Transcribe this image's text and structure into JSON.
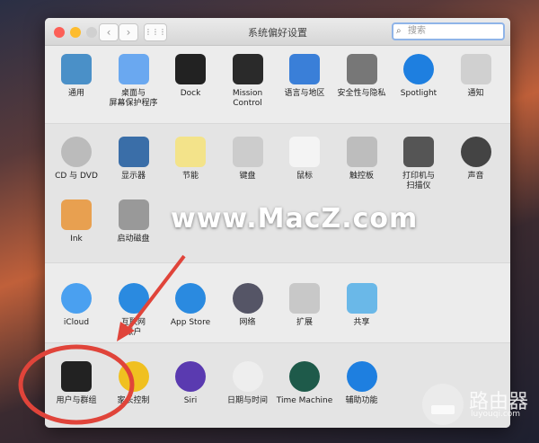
{
  "window": {
    "title": "系统偏好设置",
    "search_placeholder": "搜索",
    "back": "‹",
    "forward": "›",
    "grid": "⋮⋮⋮"
  },
  "sections": [
    [
      {
        "label": "通用",
        "icon": "general-icon",
        "color": "#4a90c8"
      },
      {
        "label": "桌面与\n屏幕保护程序",
        "icon": "desktop-icon",
        "color": "#6aa8f0"
      },
      {
        "label": "Dock",
        "icon": "dock-icon",
        "color": "#222"
      },
      {
        "label": "Mission\nControl",
        "icon": "mission-control-icon",
        "color": "#2a2a2a"
      },
      {
        "label": "语言与地区",
        "icon": "language-icon",
        "color": "#3a7fd8"
      },
      {
        "label": "安全性与隐私",
        "icon": "security-icon",
        "color": "#777"
      },
      {
        "label": "Spotlight",
        "icon": "spotlight-icon",
        "color": "#1e7fe0"
      },
      {
        "label": "通知",
        "icon": "notifications-icon",
        "color": "#d0d0d0"
      }
    ],
    [
      {
        "label": "CD 与 DVD",
        "icon": "cd-icon",
        "color": "#bbb"
      },
      {
        "label": "显示器",
        "icon": "display-icon",
        "color": "#3a6ea8"
      },
      {
        "label": "节能",
        "icon": "energy-icon",
        "color": "#f3e38a"
      },
      {
        "label": "键盘",
        "icon": "keyboard-icon",
        "color": "#ccc"
      },
      {
        "label": "鼠标",
        "icon": "mouse-icon",
        "color": "#f4f4f4"
      },
      {
        "label": "触控板",
        "icon": "trackpad-icon",
        "color": "#bdbdbd"
      },
      {
        "label": "打印机与\n扫描仪",
        "icon": "printer-icon",
        "color": "#555"
      },
      {
        "label": "声音",
        "icon": "sound-icon",
        "color": "#444"
      },
      {
        "label": "Ink",
        "icon": "ink-icon",
        "color": "#e8a050"
      },
      {
        "label": "启动磁盘",
        "icon": "startup-disk-icon",
        "color": "#999"
      }
    ],
    [
      {
        "label": "iCloud",
        "icon": "icloud-icon",
        "color": "#4aa0f0"
      },
      {
        "label": "互联网\n帐户",
        "icon": "internet-accounts-icon",
        "color": "#2a8ae0"
      },
      {
        "label": "App Store",
        "icon": "app-store-icon",
        "color": "#2a8ae0"
      },
      {
        "label": "网络",
        "icon": "network-icon",
        "color": "#556"
      },
      {
        "label": "扩展",
        "icon": "extensions-icon",
        "color": "#c8c8c8"
      },
      {
        "label": "共享",
        "icon": "sharing-icon",
        "color": "#6ab8e8"
      }
    ],
    [
      {
        "label": "用户与群组",
        "icon": "users-icon",
        "color": "#222"
      },
      {
        "label": "家长控制",
        "icon": "parental-icon",
        "color": "#f0c020"
      },
      {
        "label": "Siri",
        "icon": "siri-icon",
        "color": "#5a3ab0"
      },
      {
        "label": "日期与时间",
        "icon": "date-time-icon",
        "color": "#eee"
      },
      {
        "label": "Time Machine",
        "icon": "time-machine-icon",
        "color": "#1e5a4a"
      },
      {
        "label": "辅助功能",
        "icon": "accessibility-icon",
        "color": "#1e7fe0"
      }
    ]
  ],
  "watermark": "www.MacZ.com",
  "watermark2": {
    "name": "路由器",
    "url": "luyouqi.com"
  },
  "colors": {
    "red": "#e0443a",
    "accent": "#8fb4e8"
  }
}
